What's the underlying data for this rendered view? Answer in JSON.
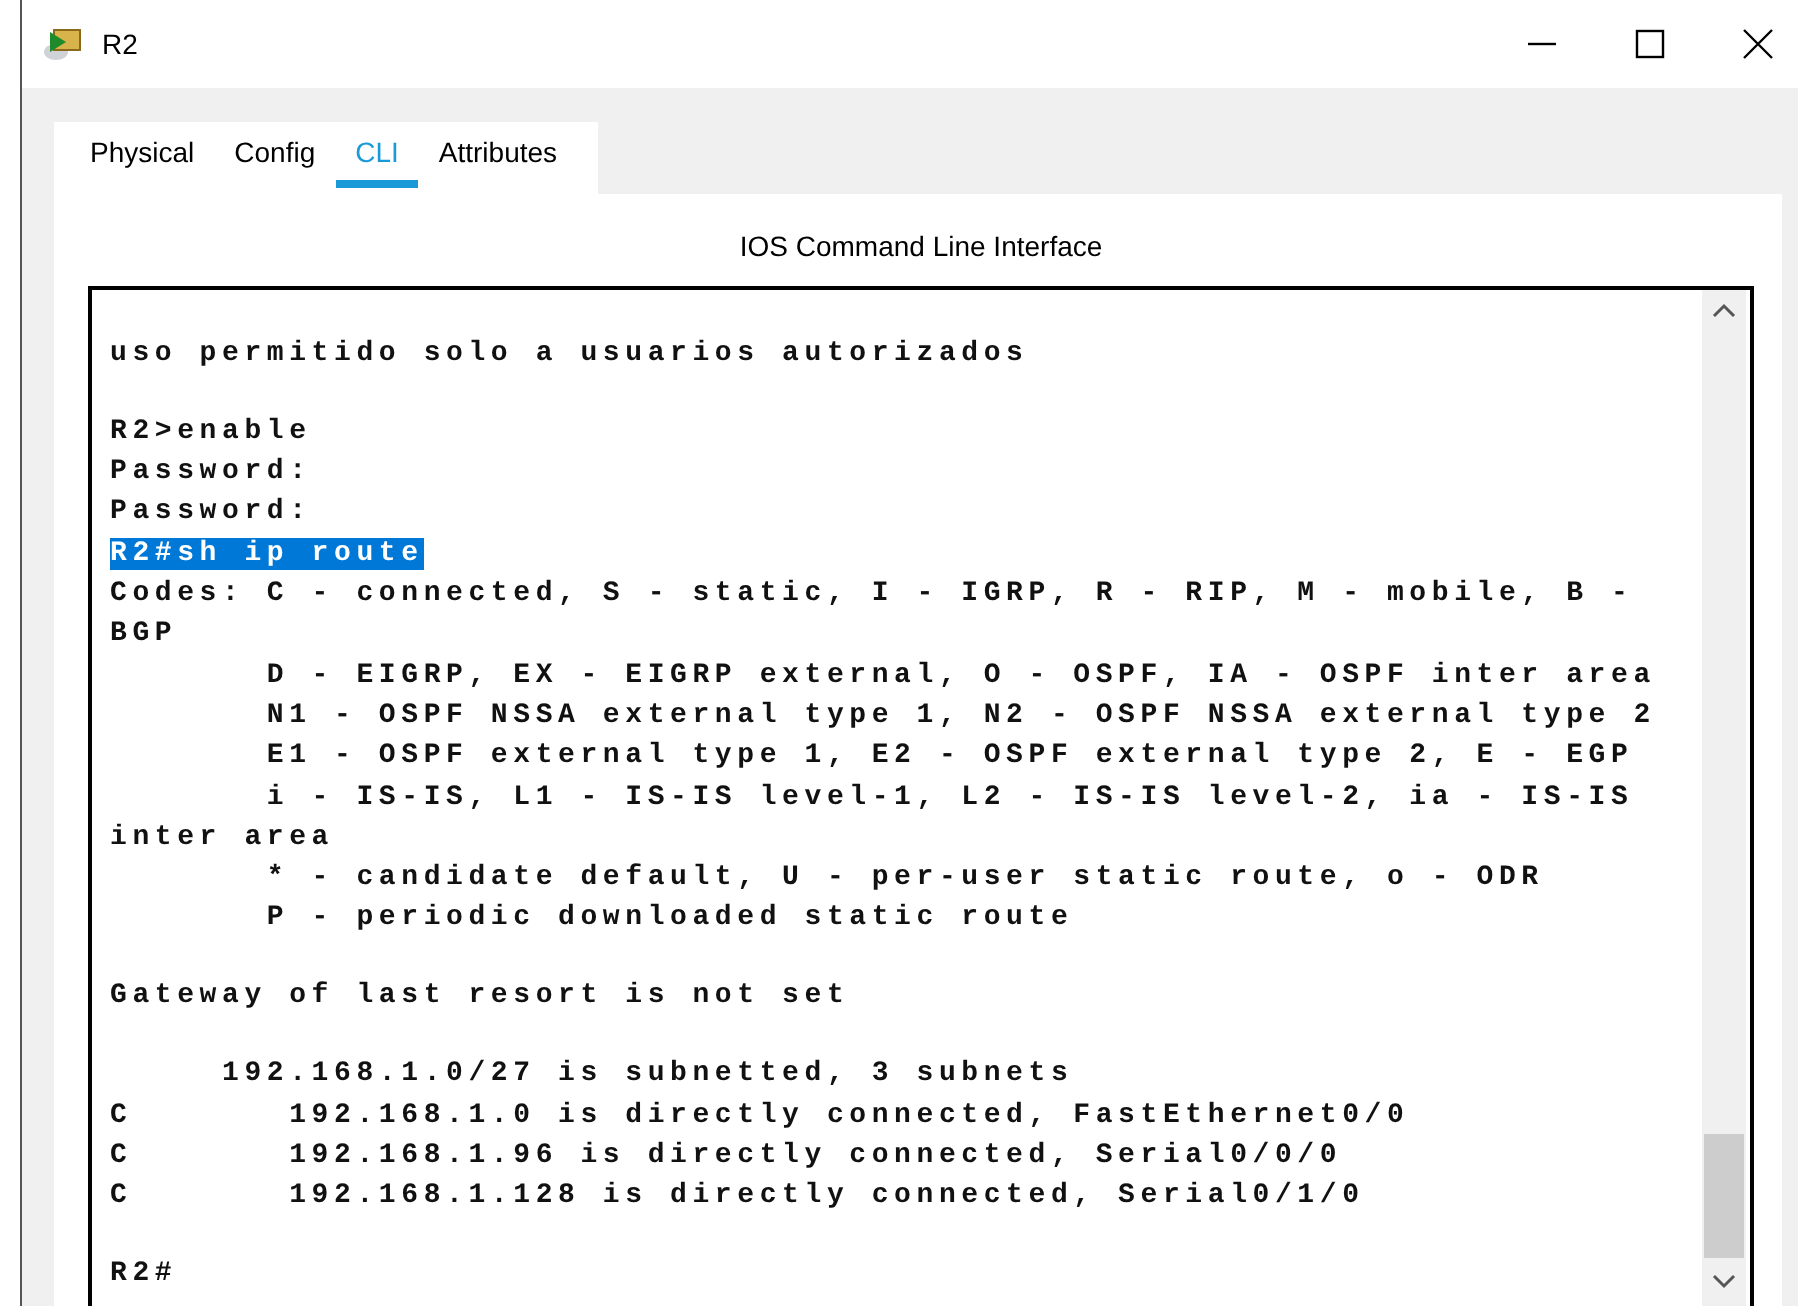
{
  "window": {
    "title": "R2"
  },
  "tabs": [
    {
      "label": "Physical",
      "selected": false
    },
    {
      "label": "Config",
      "selected": false
    },
    {
      "label": "CLI",
      "selected": true
    },
    {
      "label": "Attributes",
      "selected": false
    }
  ],
  "panel_title": "IOS Command Line Interface",
  "terminal": {
    "blocks": [
      {
        "lines": [
          {
            "text": "uso permitido solo a usuarios autorizados",
            "selected": false
          }
        ]
      },
      {
        "lines": [
          {
            "text": "R2>enable",
            "selected": false
          },
          {
            "text": "Password:",
            "selected": false
          },
          {
            "text": "Password:",
            "selected": false
          },
          {
            "text": "R2#sh ip route",
            "selected": true
          },
          {
            "text": "Codes: C - connected, S - static, I - IGRP, R - RIP, M - mobile, B -",
            "selected": false
          },
          {
            "text": "BGP",
            "selected": false
          },
          {
            "text": "       D - EIGRP, EX - EIGRP external, O - OSPF, IA - OSPF inter area",
            "selected": false
          },
          {
            "text": "       N1 - OSPF NSSA external type 1, N2 - OSPF NSSA external type 2",
            "selected": false
          },
          {
            "text": "       E1 - OSPF external type 1, E2 - OSPF external type 2, E - EGP",
            "selected": false
          },
          {
            "text": "       i - IS-IS, L1 - IS-IS level-1, L2 - IS-IS level-2, ia - IS-IS",
            "selected": false
          },
          {
            "text": "inter area",
            "selected": false
          },
          {
            "text": "       * - candidate default, U - per-user static route, o - ODR",
            "selected": false
          },
          {
            "text": "       P - periodic downloaded static route",
            "selected": false
          }
        ]
      },
      {
        "lines": [
          {
            "text": "Gateway of last resort is not set",
            "selected": false
          }
        ]
      },
      {
        "lines": [
          {
            "text": "     192.168.1.0/27 is subnetted, 3 subnets",
            "selected": false
          },
          {
            "text": "C       192.168.1.0 is directly connected, FastEthernet0/0",
            "selected": false
          },
          {
            "text": "C       192.168.1.96 is directly connected, Serial0/0/0",
            "selected": false
          },
          {
            "text": "C       192.168.1.128 is directly connected, Serial0/1/0",
            "selected": false
          }
        ]
      },
      {
        "lines": [
          {
            "text": "R2#",
            "selected": false
          }
        ]
      }
    ]
  }
}
